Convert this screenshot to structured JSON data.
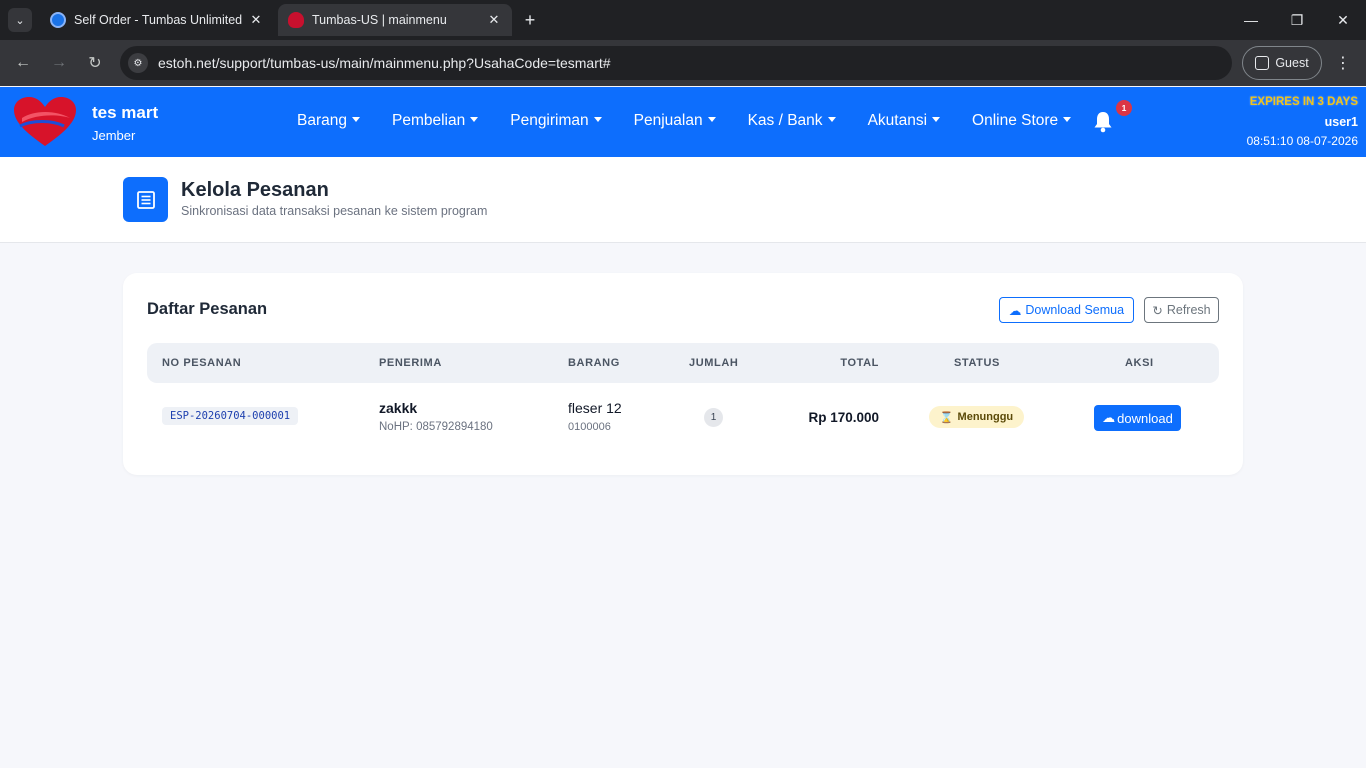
{
  "browser": {
    "tabs": [
      {
        "title": "Self Order - Tumbas Unlimited",
        "active": false
      },
      {
        "title": "Tumbas-US | mainmenu",
        "active": true
      }
    ],
    "url": "estoh.net/support/tumbas-us/main/mainmenu.php?UsahaCode=tesmart#",
    "profile_label": "Guest"
  },
  "navbar": {
    "brand_name": "tes mart",
    "brand_city": "Jember",
    "menu": [
      "Barang",
      "Pembelian",
      "Pengiriman",
      "Penjualan",
      "Kas / Bank",
      "Akutansi",
      "Online Store"
    ],
    "notification_count": "1",
    "expires_text": "EXPIRES IN 3 DAYS",
    "username": "user1",
    "datetime": "08:51:10 08-07-2026",
    "accent_color": "#0d6efd"
  },
  "page_header": {
    "title": "Kelola Pesanan",
    "subtitle": "Sinkronisasi data transaksi pesanan ke sistem program"
  },
  "orders": {
    "title": "Daftar Pesanan",
    "download_all_label": "Download Semua",
    "refresh_label": "Refresh",
    "columns": [
      "NO PESANAN",
      "PENERIMA",
      "BARANG",
      "JUMLAH",
      "TOTAL",
      "STATUS",
      "AKSI"
    ],
    "rows": [
      {
        "order_no": "ESP-20260704-000001",
        "recipient": "zakkk",
        "phone": "NoHP: 085792894180",
        "item_name": "fleser 12",
        "item_code": "0100006",
        "qty": "1",
        "total": "Rp 170.000",
        "status": "Menunggu",
        "action_label": "download"
      }
    ]
  }
}
